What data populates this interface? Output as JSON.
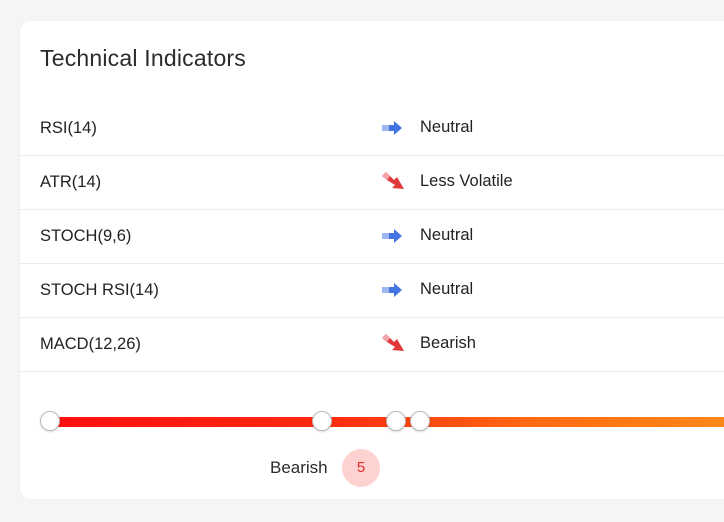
{
  "panel": {
    "title": "Technical Indicators"
  },
  "indicators": [
    {
      "name": "RSI(14)",
      "signal": "Neutral",
      "icon": "arrow-right-icon",
      "color": "#3b6ee0"
    },
    {
      "name": "ATR(14)",
      "signal": "Less Volatile",
      "icon": "arrow-down-right-icon",
      "color": "#e0383b"
    },
    {
      "name": "STOCH(9,6)",
      "signal": "Neutral",
      "icon": "arrow-right-icon",
      "color": "#3b6ee0"
    },
    {
      "name": "STOCH RSI(14)",
      "signal": "Neutral",
      "icon": "arrow-right-icon",
      "color": "#3b6ee0"
    },
    {
      "name": "MACD(12,26)",
      "signal": "Bearish",
      "icon": "arrow-down-right-icon",
      "color": "#e0383b"
    }
  ],
  "summary": {
    "label": "Bearish",
    "count": "5",
    "badge_color": "#e02b2b",
    "badge_bg": "#ffd2d2"
  },
  "colors": {
    "neutral": "#3b6ee0",
    "bearish": "#e0383b",
    "track_start": "#ff0f0f",
    "track_end": "#ff8a1a"
  }
}
